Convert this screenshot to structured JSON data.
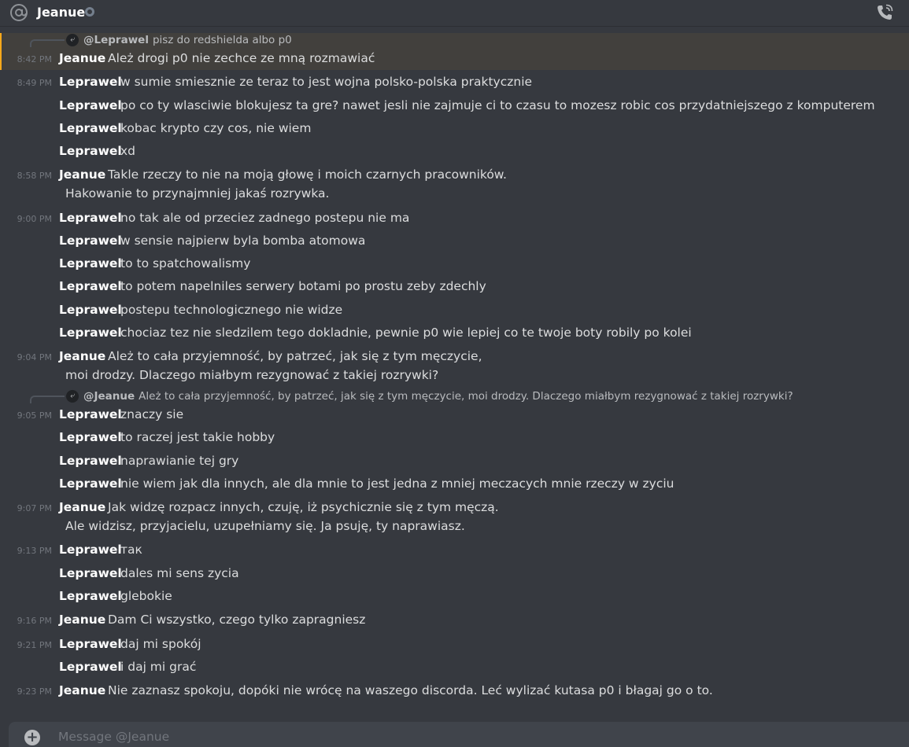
{
  "header": {
    "channel_name": "Jeanue",
    "icons": {
      "at": "at-icon",
      "status": "offline-status-icon",
      "call": "voice-call-icon"
    }
  },
  "replies": [
    {
      "author": "@Leprawel",
      "text": "pisz do redshielda albo p0"
    },
    {
      "author": "@Jeanue",
      "text": "Ależ to cała przyjemność, by patrzeć, jak się z tym męczycie, moi drodzy. Dlaczego miałbym rezygnować z takiej rozrywki?"
    }
  ],
  "messages": [
    {
      "time": "8:42 PM",
      "author": "Jeanue",
      "text": "Ależ drogi p0 nie zechce ze mną rozmawiać"
    },
    {
      "time": "8:49 PM",
      "author": "Leprawel",
      "text": "w sumie smiesznie ze teraz to jest wojna polsko-polska praktycznie"
    },
    {
      "author": "Leprawel",
      "text": "po co ty wlasciwie blokujesz ta gre? nawet jesli nie zajmuje ci to czasu to mozesz robic cos przydatniejszego z komputerem"
    },
    {
      "author": "Leprawel",
      "text": "kobac krypto czy cos, nie wiem"
    },
    {
      "author": "Leprawel",
      "text": "xd"
    },
    {
      "time": "8:58 PM",
      "author": "Jeanue",
      "text": "Takle rzeczy to nie na moją głowę i moich czarnych pracowników.",
      "text2": "Hakowanie to przynajmniej jakaś rozrywka."
    },
    {
      "time": "9:00 PM",
      "author": "Leprawel",
      "text": "no tak ale od przeciez zadnego postepu nie ma"
    },
    {
      "author": "Leprawel",
      "text": "w sensie najpierw byla bomba atomowa"
    },
    {
      "author": "Leprawel",
      "text": "to to spatchowalismy"
    },
    {
      "author": "Leprawel",
      "text": "to potem napelniles serwery botami po prostu zeby zdechly"
    },
    {
      "author": "Leprawel",
      "text": "postepu technologicznego nie widze"
    },
    {
      "author": "Leprawel",
      "text": "chociaz tez nie sledzilem tego dokladnie, pewnie p0 wie lepiej co te twoje boty robily po kolei"
    },
    {
      "time": "9:04 PM",
      "author": "Jeanue",
      "text": "Ależ to cała przyjemność, by patrzeć, jak się z tym męczycie,",
      "text2": "moi drodzy. Dlaczego miałbym rezygnować z takiej rozrywki?"
    },
    {
      "time": "9:05 PM",
      "author": "Leprawel",
      "text": "znaczy sie"
    },
    {
      "author": "Leprawel",
      "text": "to raczej jest takie hobby"
    },
    {
      "author": "Leprawel",
      "text": "naprawianie tej gry"
    },
    {
      "author": "Leprawel",
      "text": "nie wiem jak dla innych, ale dla mnie to jest jedna z mniej meczacych mnie rzeczy w zyciu"
    },
    {
      "time": "9:07 PM",
      "author": "Jeanue",
      "text": "Jak widzę rozpacz innych, czuję, iż psychicznie się z tym męczą.",
      "text2": "Ale widzisz, przyjacielu, uzupełniamy się. Ja psuję, ty naprawiasz."
    },
    {
      "time": "9:13 PM",
      "author": "Leprawel",
      "text": "так"
    },
    {
      "author": "Leprawel",
      "text": "dales mi sens zycia"
    },
    {
      "author": "Leprawel",
      "text": "glebokie"
    },
    {
      "time": "9:16 PM",
      "author": "Jeanue",
      "text": "Dam Ci wszystko, czego tylko  zapragniesz"
    },
    {
      "time": "9:21 PM",
      "author": "Leprawel",
      "text": "daj mi spokój"
    },
    {
      "author": "Leprawel",
      "text": "i daj mi grać"
    },
    {
      "time": "9:23 PM",
      "author": "Jeanue",
      "text": "Nie zaznasz spokoju, dopóki nie wrócę na waszego discorda. Leć wylizać kutasa p0 i błagaj go o to."
    }
  ],
  "composer": {
    "placeholder": "Message @Jeanue",
    "icon": "plus-circle-icon"
  },
  "colors": {
    "background": "#36393f",
    "highlight": "#49443c",
    "highlight_bar": "#faa81a",
    "text": "#dcddde",
    "muted": "#72767d"
  }
}
